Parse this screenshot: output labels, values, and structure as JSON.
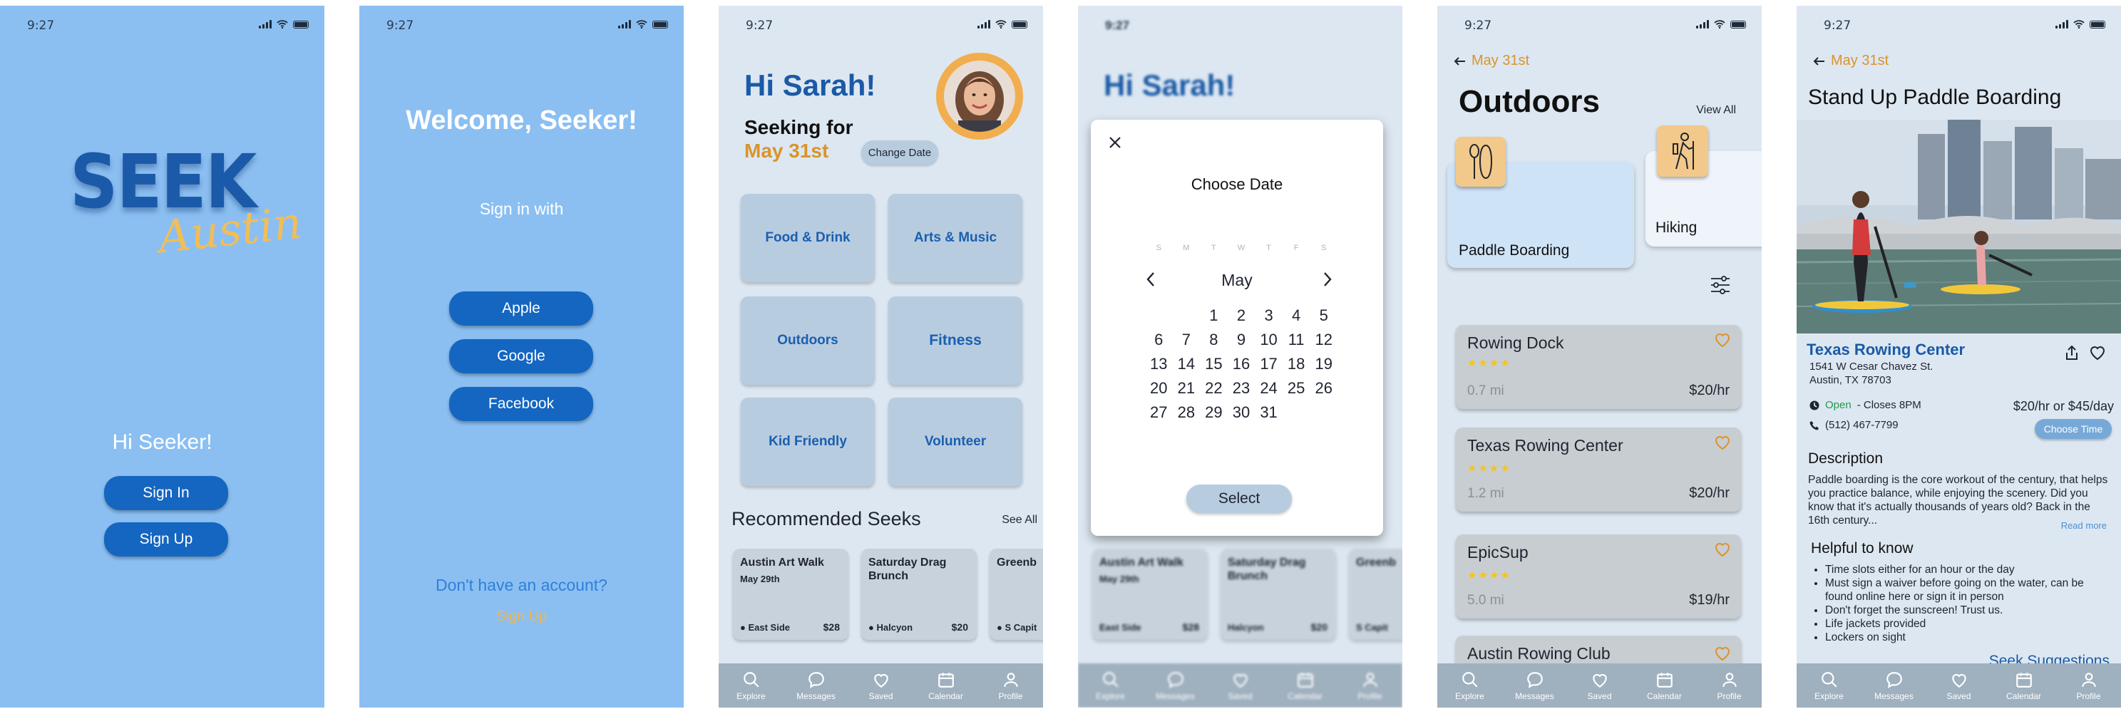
{
  "status": {
    "time": "9:27"
  },
  "tabbar": [
    {
      "label": "Explore",
      "icon": "search-icon"
    },
    {
      "label": "Messages",
      "icon": "message-icon"
    },
    {
      "label": "Saved",
      "icon": "heart-icon"
    },
    {
      "label": "Calendar",
      "icon": "calendar-icon"
    },
    {
      "label": "Profile",
      "icon": "profile-icon"
    }
  ],
  "colors": {
    "screen_blue": "#8bbff2",
    "accent_gold": "#d9942b",
    "primary_blue": "#1466c0",
    "light_bg": "#dde7f1"
  },
  "screen1": {
    "logo_main": "SEEK",
    "logo_script": "Austin",
    "greeting": "Hi Seeker!",
    "sign_in": "Sign In",
    "sign_up": "Sign Up"
  },
  "screen2": {
    "welcome": "Welcome, Seeker!",
    "sign_in_with": "Sign in with",
    "apple": "Apple",
    "google": "Google",
    "facebook": "Facebook",
    "no_account": "Don't have an account?",
    "sign_up": "Sign Up"
  },
  "screen3": {
    "greeting": "Hi Sarah!",
    "seeking_for": "Seeking for",
    "date": "May 31st",
    "change_date": "Change Date",
    "categories": [
      "Food & Drink",
      "Arts & Music",
      "Outdoors",
      "Fitness",
      "Kid Friendly",
      "Volunteer"
    ],
    "recommended_title": "Recommended Seeks",
    "see_all": "See All",
    "recs": [
      {
        "title": "Austin Art Walk",
        "date": "May 29th",
        "location": "East Side",
        "price": "$28"
      },
      {
        "title": "Saturday Drag Brunch",
        "date": "",
        "location": "Halcyon",
        "price": "$20"
      },
      {
        "title": "Greenb",
        "date": "",
        "location": "S Capit",
        "price": ""
      }
    ]
  },
  "screen4": {
    "greeting": "Hi Sarah!",
    "modal_title": "Choose Date",
    "month": "May",
    "weekdays": [
      "S",
      "M",
      "T",
      "W",
      "T",
      "F",
      "S"
    ],
    "days": [
      "",
      "",
      "1",
      "2",
      "3",
      "4",
      "5",
      "6",
      "7",
      "8",
      "9",
      "10",
      "11",
      "12",
      "13",
      "14",
      "15",
      "16",
      "17",
      "18",
      "19",
      "20",
      "21",
      "22",
      "23",
      "24",
      "25",
      "26",
      "27",
      "28",
      "29",
      "30",
      "31"
    ],
    "select": "Select",
    "recs": [
      {
        "title": "Austin Art Walk",
        "date": "May 29th",
        "location": "East Side",
        "price": "$28"
      },
      {
        "title": "Saturday Drag Brunch",
        "location": "Halcyon",
        "price": "$20"
      },
      {
        "title": "Greenb",
        "location": "S Capit"
      }
    ]
  },
  "screen5": {
    "back_label": "May 31st",
    "title": "Outdoors",
    "view_all": "View All",
    "activities": [
      {
        "label": "Paddle Boarding",
        "icon": "paddle-icon"
      },
      {
        "label": "Hiking",
        "icon": "hiker-icon"
      }
    ],
    "places": [
      {
        "name": "Rowing Dock",
        "stars": "★★★★",
        "distance": "0.7 mi",
        "price": "$20/hr"
      },
      {
        "name": "Texas Rowing Center",
        "stars": "★★★★",
        "distance": "1.2 mi",
        "price": "$20/hr"
      },
      {
        "name": "EpicSup",
        "stars": "★★★★",
        "distance": "5.0 mi",
        "price": "$19/hr"
      },
      {
        "name": "Austin Rowing Club",
        "stars": "",
        "distance": "",
        "price": ""
      }
    ]
  },
  "screen6": {
    "back_label": "May 31st",
    "title": "Stand Up Paddle Boarding",
    "venue": "Texas Rowing Center",
    "address1": "1541 W Cesar Chavez St.",
    "address2": "Austin, TX 78703",
    "open": "Open",
    "closes": "- Closes 8PM",
    "phone": "(512) 467-7799",
    "price": "$20/hr or $45/day",
    "choose_time": "Choose Time",
    "description_title": "Description",
    "description": "Paddle boarding is the core workout of the century, that helps you practice balance, while enjoying the scenery. Did you know that it's actually thousands of years old? Back in the 16th century...",
    "read_more": "Read more",
    "helpful_title": "Helpful to know",
    "helpful": [
      "Time slots either for an hour or the day",
      "Must sign a waiver before going on the water, can be found online here or sign it in person",
      "Don't forget the sunscreen! Trust us.",
      "Life jackets provided",
      "Lockers on sight"
    ],
    "seek_suggestions": "Seek Suggestions"
  }
}
